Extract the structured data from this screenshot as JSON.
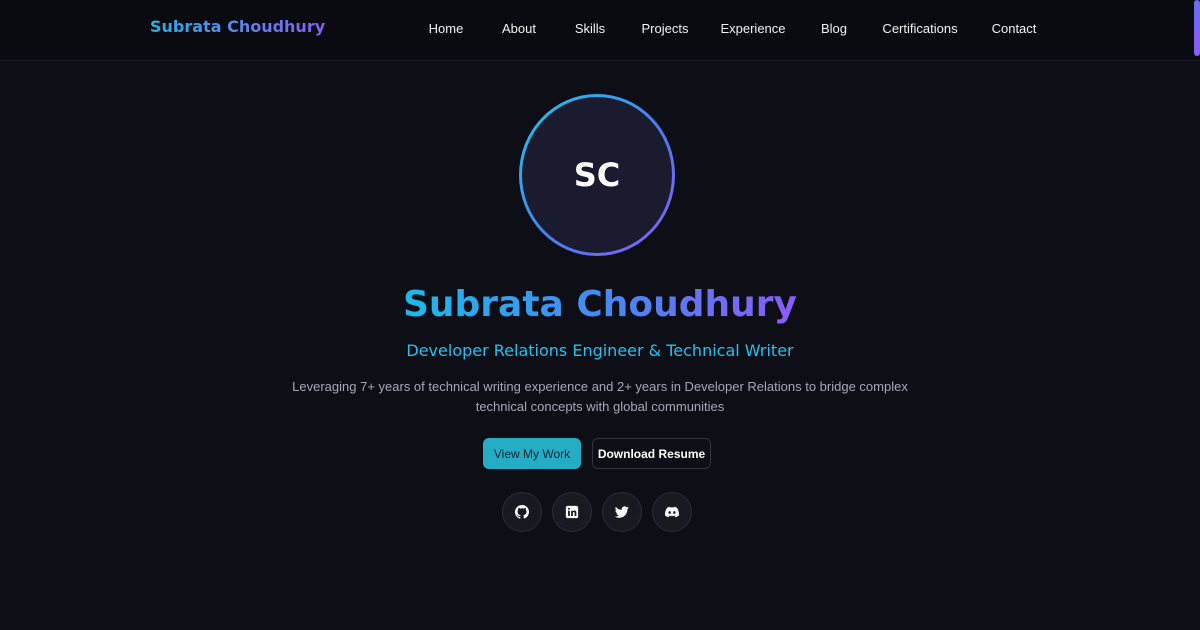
{
  "nav": {
    "brand": "Subrata Choudhury",
    "links": [
      "Home",
      "About",
      "Skills",
      "Projects",
      "Experience",
      "Blog",
      "Certifications",
      "Contact"
    ]
  },
  "hero": {
    "avatar_initials": "SC",
    "name": "Subrata Choudhury",
    "role": "Developer Relations Engineer & Technical Writer",
    "description": "Leveraging 7+ years of technical writing experience and 2+ years in Developer Relations to bridge complex technical concepts with global communities",
    "primary_button": "View My Work",
    "secondary_button": "Download Resume"
  },
  "social": {
    "icons": [
      "github-icon",
      "linkedin-icon",
      "twitter-icon",
      "discord-icon"
    ]
  },
  "colors": {
    "background": "#0d0e16",
    "accent_cyan": "#22c3ee",
    "accent_purple": "#8a5cf6",
    "primary_button": "#25adc5"
  }
}
